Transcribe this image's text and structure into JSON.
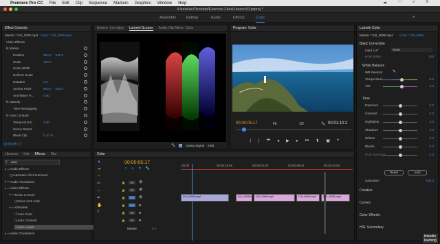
{
  "menubar": {
    "app": "Premiere Pro CC",
    "items": [
      "File",
      "Edit",
      "Clip",
      "Sequence",
      "Markers",
      "Graphics",
      "Window",
      "Help"
    ]
  },
  "titlebar": {
    "path": "/Users/ac/Desktop/Exercise Files/Lesson10.prproj *"
  },
  "workspaces": {
    "tabs": [
      "Assembly",
      "Editing",
      "Audio",
      "Effects",
      "Color"
    ],
    "active": "Color",
    "more": "»"
  },
  "effect_controls": {
    "tabs": [
      "Effect Controls"
    ],
    "master": "Master * DJI_0006.mp4",
    "clip": "Color * DJI_0006.mp4",
    "section": "Video Effects",
    "rows": [
      {
        "label": "fx  Motion"
      },
      {
        "label": "Position",
        "v1": "960.0",
        "v2": "540.0"
      },
      {
        "label": "Scale",
        "v1": "100.0"
      },
      {
        "label": "Scale Width"
      },
      {
        "label": "Uniform Scale"
      },
      {
        "label": "Rotation",
        "v1": "0.0"
      },
      {
        "label": "Anchor Point",
        "v1": "960.0",
        "v2": "540.0"
      },
      {
        "label": "Anti-flicker Fi...",
        "v1": "0.00"
      },
      {
        "label": "fx  Opacity"
      },
      {
        "label": "Time Remapping"
      },
      {
        "label": "fx  Auto Contrast"
      },
      {
        "label": "Temporal Sm...",
        "v1": "0.00"
      },
      {
        "label": "Scene Detect"
      },
      {
        "label": "Black Clip",
        "v1": "0.10 %"
      }
    ],
    "timecode": "00:00:05:17"
  },
  "scopes": {
    "tabs": [
      "Source: (no clips)",
      "Lumetri Scopes",
      "Audio Clip Mixer: Color"
    ],
    "active": "Lumetri Scopes",
    "clamp_label": "Clamp Signal",
    "bit_depth": "8 Bit"
  },
  "program": {
    "tab": "Program: Color",
    "timecode": "00:00:05:17",
    "fit": "Fit",
    "fraction": "1/2",
    "duration": "00:01:10:2"
  },
  "lumetri": {
    "tab": "Lumetri Color",
    "master": "Master * DJI_0006.mp4",
    "clip": "Color * DJI_0006...",
    "sections": {
      "basic": "Basic Correction",
      "input_lut": "Input LUT",
      "lut_value": "None",
      "hdr_white": "HDR White",
      "hdr_white_val": "100",
      "white_balance": "White Balance",
      "wb_selector": "WB Selector",
      "tone": "Tone",
      "creative": "Creative",
      "curves": "Curves",
      "color_wheels": "Color Wheels",
      "hsl": "HSL Secondary"
    },
    "wb_rows": [
      {
        "label": "Temperature",
        "value": "0.0",
        "pos": 0.55
      },
      {
        "label": "Tint",
        "value": "0.0",
        "pos": 0.55
      }
    ],
    "tone_rows": [
      {
        "label": "Exposure",
        "value": "0.0",
        "pos": 0.5
      },
      {
        "label": "Contrast",
        "value": "0.0",
        "pos": 0.5
      },
      {
        "label": "Highlights",
        "value": "0.0",
        "pos": 0.5
      },
      {
        "label": "Shadows",
        "value": "0.0",
        "pos": 0.5
      },
      {
        "label": "Whites",
        "value": "0.0",
        "pos": 0.5
      },
      {
        "label": "Blacks",
        "value": "0.0",
        "pos": 0.5
      },
      {
        "label": "HDR Specular",
        "value": "0.0",
        "pos": 0.5
      }
    ],
    "reset": "Reset",
    "auto": "Auto",
    "saturation_label": "Saturation",
    "saturation": "100.0"
  },
  "effects": {
    "tabs": [
      "Libraries",
      "Info",
      "Effects",
      "Mar"
    ],
    "active": "Effects",
    "search": "auto",
    "tree": [
      {
        "label": "Audio Effects",
        "indent": 0,
        "folder": true
      },
      {
        "label": "Automatic Click Remover",
        "indent": 1,
        "folder": false
      },
      {
        "label": "Audio Transitions",
        "indent": 0,
        "folder": true
      },
      {
        "label": "Video Effects",
        "indent": 0,
        "folder": true
      },
      {
        "label": "Noise & Grain",
        "indent": 1,
        "folder": true
      },
      {
        "label": "Noise HLS Auto",
        "indent": 2,
        "folder": false
      },
      {
        "label": "Obsolete",
        "indent": 1,
        "folder": true
      },
      {
        "label": "Auto Color",
        "indent": 2,
        "folder": false
      },
      {
        "label": "Auto Contrast",
        "indent": 2,
        "folder": false
      },
      {
        "label": "Auto Levels",
        "indent": 2,
        "folder": false,
        "selected": true
      },
      {
        "label": "Video Transitions",
        "indent": 0,
        "folder": true
      }
    ]
  },
  "timeline": {
    "tab": "Color",
    "timecode": "00:00:05:17",
    "ruler": [
      ":00:00",
      "00:00:16:00",
      "00:00:32:00",
      "00:00:48:00",
      "00:01:04:00"
    ],
    "video_tracks": [
      "V3",
      "V2",
      "V1"
    ],
    "audio_tracks": [
      "A1",
      "A2",
      "A3"
    ],
    "master": "Master",
    "master_val": "0.0",
    "clip_label": "DJI_0006.mp4"
  },
  "watermark": "linkedin learning"
}
